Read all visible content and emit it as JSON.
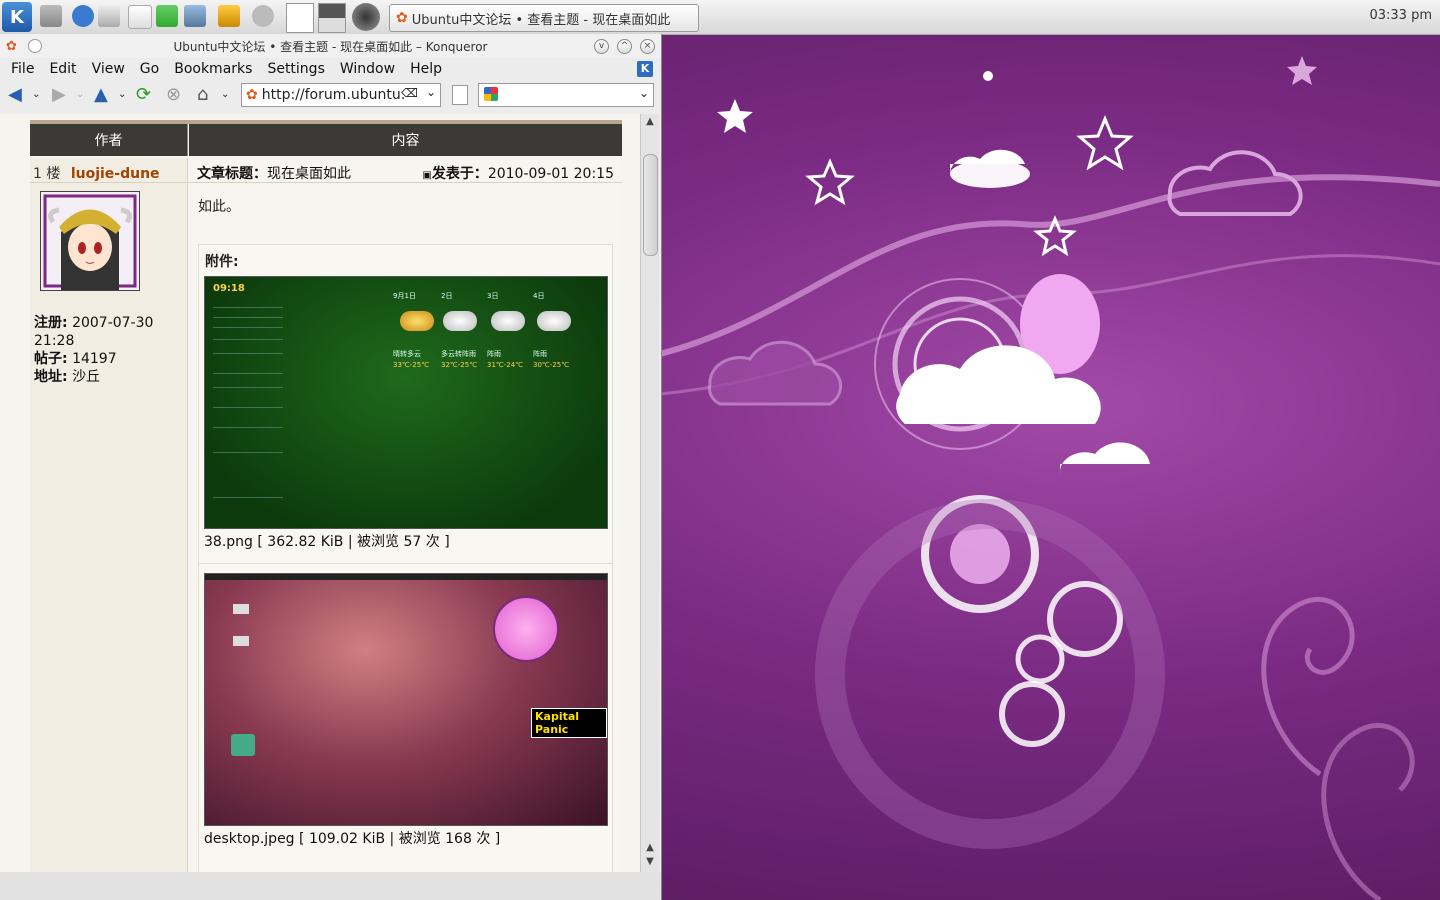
{
  "panel": {
    "k_menu": "K",
    "task_title": "Ubuntu中文论坛 • 查看主题 - 现在桌面如此",
    "clock": "03:33 pm"
  },
  "window": {
    "title": "Ubuntu中文论坛 • 查看主题 - 现在桌面如此 – Konqueror"
  },
  "menubar": [
    "File",
    "Edit",
    "View",
    "Go",
    "Bookmarks",
    "Settings",
    "Window",
    "Help"
  ],
  "toolbar": {
    "url": "http://forum.ubuntu.",
    "search": ""
  },
  "forum": {
    "col_author": "作者",
    "col_content": "内容",
    "post_number": "1 楼",
    "author": "luojie-dune",
    "subject_label": "文章标题：",
    "subject": "现在桌面如此",
    "posted_label": "发表于：",
    "posted": "2010-09-01 20:15",
    "body": "如此。",
    "attachments_label": "附件:",
    "profile": {
      "registered_label": "注册:",
      "registered": "2007-07-30",
      "registered_time": "21:28",
      "posts_label": "帖子:",
      "posts": "14197",
      "location_label": "地址:",
      "location": "沙丘"
    },
    "attachments": [
      {
        "name": "38.png",
        "size": "362.82 KiB",
        "views": "被浏览 57 次"
      },
      {
        "name": "desktop.jpeg",
        "size": "109.02 KiB",
        "views": "被浏览 168 次"
      }
    ],
    "thumb1": {
      "time": "09:18",
      "days": [
        "9月1日",
        "2日",
        "3日",
        "4日"
      ],
      "weather": [
        "晴转多云",
        "多云转阵雨",
        "阵雨",
        "阵雨"
      ],
      "temps": [
        "33℃-25℃",
        "32℃-25℃",
        "31℃-24℃",
        "30℃-25℃"
      ]
    },
    "thumb2": {
      "game_label": "Kapital Panic"
    }
  },
  "colors": {
    "header_bg": "#3b3a36",
    "author_link": "#a04400",
    "wallpaper": "#7a2a82"
  }
}
